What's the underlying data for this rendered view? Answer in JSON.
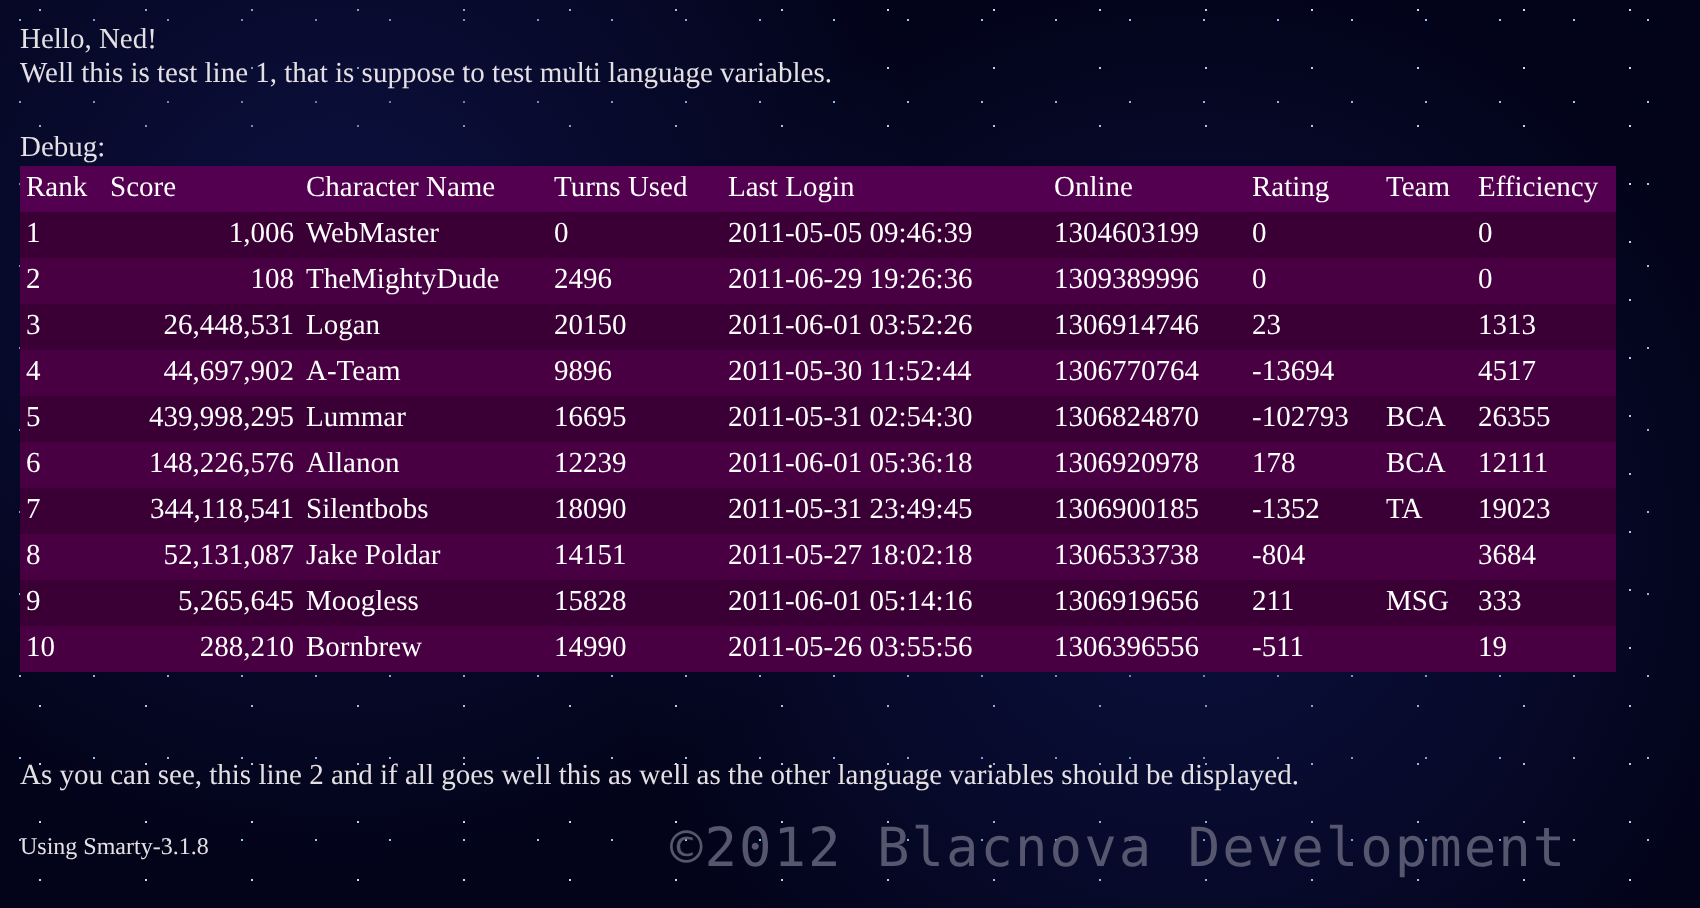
{
  "greeting": "Hello, Ned!",
  "line_1": "Well this is test line 1, that is suppose to test multi language variables.",
  "debug_label": "Debug:",
  "table": {
    "columns": [
      "Rank",
      "Score",
      "Character Name",
      "Turns Used",
      "Last Login",
      "Online",
      "Rating",
      "Team",
      "Efficiency"
    ],
    "rows": [
      [
        "1",
        "1,006",
        "WebMaster",
        "0",
        "2011-05-05 09:46:39",
        "1304603199",
        "0",
        "",
        "0"
      ],
      [
        "2",
        "108",
        "TheMightyDude",
        "2496",
        "2011-06-29 19:26:36",
        "1309389996",
        "0",
        "",
        "0"
      ],
      [
        "3",
        "26,448,531",
        "Logan",
        "20150",
        "2011-06-01 03:52:26",
        "1306914746",
        "23",
        "",
        "1313"
      ],
      [
        "4",
        "44,697,902",
        "A-Team",
        "9896",
        "2011-05-30 11:52:44",
        "1306770764",
        "-13694",
        "",
        "4517"
      ],
      [
        "5",
        "439,998,295",
        "Lummar",
        "16695",
        "2011-05-31 02:54:30",
        "1306824870",
        "-102793",
        "BCA",
        "26355"
      ],
      [
        "6",
        "148,226,576",
        "Allanon",
        "12239",
        "2011-06-01 05:36:18",
        "1306920978",
        "178",
        "BCA",
        "12111"
      ],
      [
        "7",
        "344,118,541",
        "Silentbobs",
        "18090",
        "2011-05-31 23:49:45",
        "1306900185",
        "-1352",
        "TA",
        "19023"
      ],
      [
        "8",
        "52,131,087",
        "Jake Poldar",
        "14151",
        "2011-05-27 18:02:18",
        "1306533738",
        "-804",
        "",
        "3684"
      ],
      [
        "9",
        "5,265,645",
        "Moogless",
        "15828",
        "2011-06-01 05:14:16",
        "1306919656",
        "211",
        "MSG",
        "333"
      ],
      [
        "10",
        "288,210",
        "Bornbrew",
        "14990",
        "2011-05-26 03:55:56",
        "1306396556",
        "-511",
        "",
        "19"
      ]
    ]
  },
  "line_2": "As you can see, this line 2 and if all goes well this as well as the other language variables should be displayed.",
  "footer": {
    "engine": "Using Smarty-3.1.8",
    "copyright": "©2012 Blacnova Development"
  }
}
